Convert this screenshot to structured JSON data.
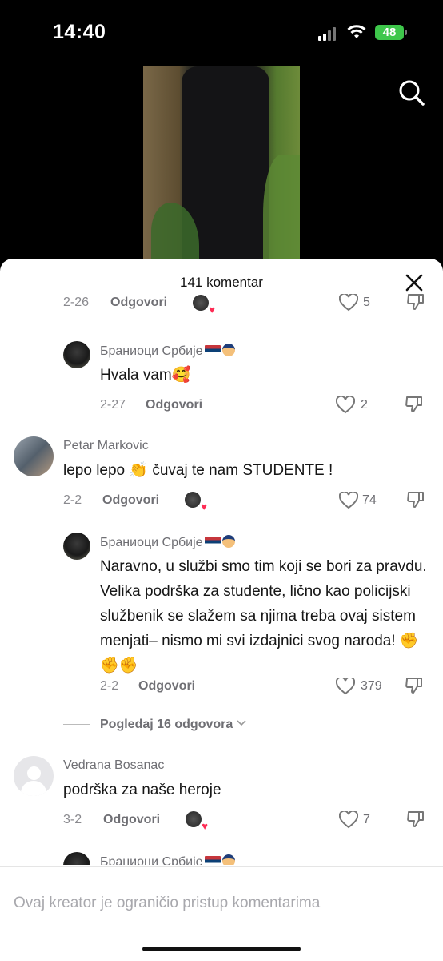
{
  "status": {
    "time": "14:40",
    "battery": "48"
  },
  "sheet": {
    "title": "141 komentar"
  },
  "comments": [
    {
      "id": "partial-top",
      "date": "2-26",
      "reply_label": "Odgovori",
      "likes": "5"
    },
    {
      "id": "reply-1",
      "name": "Брaниоци Србије",
      "text": "Hvala vam🥰",
      "date": "2-27",
      "reply_label": "Odgovori",
      "likes": "2"
    },
    {
      "id": "petar",
      "name": "Petar Markovic",
      "text": "lepo lepo 👏 čuvaj te nam STUDENTE !",
      "date": "2-2",
      "reply_label": "Odgovori",
      "likes": "74"
    },
    {
      "id": "reply-2",
      "name": "Брaниоци Србије",
      "text": "Naravno, u službi smo tim koji se bori za pravdu. Velika podrška za studente, lično kao policijski službenik se slažem sa njima treba ovaj sistem menjati– nismo mi svi izdajnici svog naroda! ✊✊✊",
      "date": "2-2",
      "reply_label": "Odgovori",
      "likes": "379"
    },
    {
      "id": "vedrana",
      "name": "Vedrana Bosanac",
      "text": "podrška za naše heroje",
      "date": "3-2",
      "reply_label": "Odgovori",
      "likes": "7"
    },
    {
      "id": "partial-bottom",
      "name": "Брaниоци Србије"
    }
  ],
  "view_more": "Pogledaj 16 odgovora",
  "footer": {
    "text": "Ovaj kreator je ograničio pristup komentarima"
  },
  "colors": {
    "accent_red": "#fe2c55",
    "battery_green": "#3ec74b"
  },
  "icons": [
    "search-icon",
    "close-icon",
    "heart-icon",
    "dislike-icon",
    "chevron-down-icon"
  ]
}
